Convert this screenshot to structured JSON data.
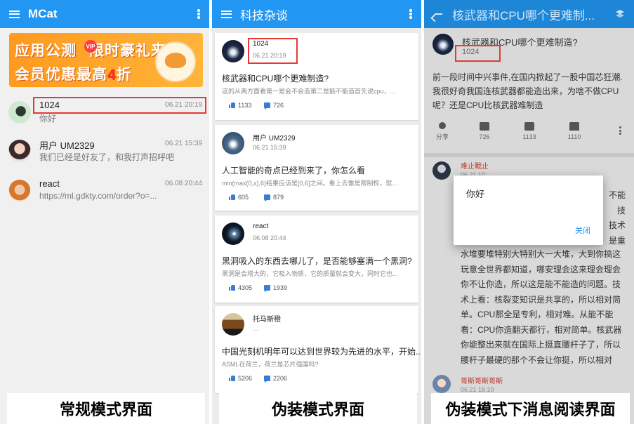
{
  "panel1": {
    "app_title": "MCat",
    "banner": {
      "line1_a": "应用公测",
      "line1_b": "限时豪礼来袭",
      "badge": "VIP",
      "line2_a": "会员优惠最高",
      "line2_b": "4",
      "line2_c": "折"
    },
    "chats": [
      {
        "name": "1024",
        "time": "06.21 20:19",
        "msg": "你好"
      },
      {
        "name": "用户 UM2329",
        "time": "06.21 15:39",
        "msg": "我们已经是好友了，和我打声招呼吧"
      },
      {
        "name": "react",
        "time": "06.08 20:44",
        "msg": "https://ml.gdkty.com/order?o=..."
      }
    ],
    "caption": "常规模式界面"
  },
  "panel2": {
    "app_title": "科技杂谈",
    "posts": [
      {
        "author": "1024",
        "date": "06.21 20:19",
        "title": "核武器和CPU哪个更难制造?",
        "preview": "这的从两方面看第一是会不会造第二是能不能造首先说cpu，...",
        "likes": "1133",
        "comments": "726"
      },
      {
        "author": "用户 UM2329",
        "date": "06.21 15:39",
        "title": "人工智能的奇点已经到来了，你怎么看",
        "preview": "min(max(0,x),6)结果应该是[0,6]之间。看上去像是限制权，就...",
        "likes": "605",
        "comments": "879"
      },
      {
        "author": "react",
        "date": "06.08 20:44",
        "title": "黑洞吸入的东西去哪儿了，是否能够塞满一个黑洞?",
        "preview": "黑洞是会增大的，它吸入物质，它的质量就会变大，同时它也...",
        "likes": "4305",
        "comments": "1939"
      },
      {
        "author": "托马斯橙",
        "date": "...",
        "title": "中国光刻机明年可以达到世界较为先进的水平，开始...",
        "preview": "ASML在荷兰，荷兰是芯片强国吗?",
        "likes": "5206",
        "comments": "2206"
      }
    ],
    "caption": "伪装模式界面"
  },
  "panel3": {
    "app_title": "核武器和CPU哪个更难制...",
    "question_title": "核武器和CPU哪个更难制造?",
    "question_author": "1024",
    "body": "前一段时间中兴事件,在国内掀起了一股中国芯狂潮.我很好奇我国连核武器都能造出来，为啥不做CPU呢？还是CPU比核武器难制造",
    "actions": {
      "share": "分享",
      "comments": "726",
      "likes": "1133",
      "dislikes": "1110"
    },
    "reply1": {
      "name": "难止戰止",
      "date": "06.21 10:...",
      "text_right": [
        "不能",
        "技",
        "技术",
        "是重"
      ],
      "text": "水堆要堆特别大特别大一大堆，大到你搞这玩意全世界都知道，哪安理会这来理会理会你不让你造，所以这是能不能造的问题。技术上看：核裂变知识是共享的，所以相对简单。CPU那全是专利，相对难。从能不能看：CPU你造翻天都行，相对简单。核武器你能整出来就在国际上挺直腰杆子了，所以腰杆子最硬的那个不会让你挺，所以相对难。"
    },
    "reply2": {
      "name": "哥斯哥斯哥斯",
      "date": "06.21 16:10"
    },
    "dialog": {
      "message": "你好",
      "button": "关闭"
    },
    "caption": "伪装模式下消息阅读界面"
  },
  "colors": {
    "primary": "#2196f3",
    "highlight": "#e53935",
    "banner": "#ff9a1e"
  }
}
